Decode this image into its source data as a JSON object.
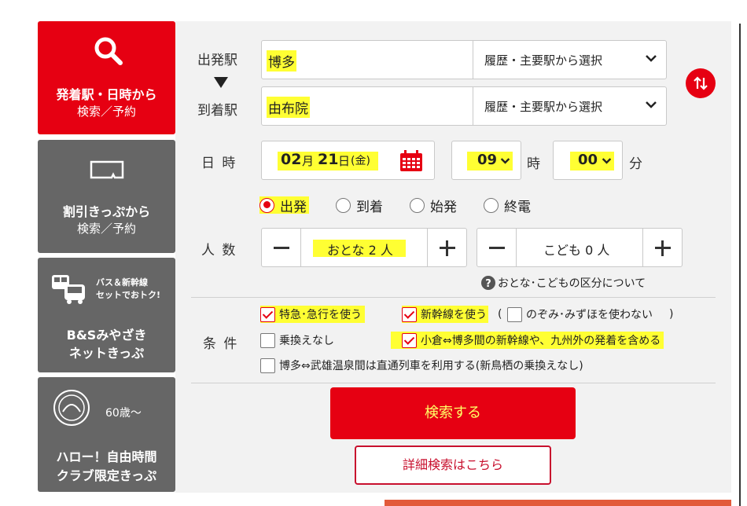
{
  "nav": {
    "tab1": {
      "line1": "発着駅・日時から",
      "line2": "検索／予約"
    },
    "tab2": {
      "line1": "割引きっぷから",
      "line2": "検索／予約"
    },
    "tab3": {
      "badge1": "バス＆新幹線",
      "badge2": "セットでおトク!",
      "line1": "B&Sみやざき",
      "line2": "ネットきっぷ"
    },
    "tab4": {
      "age": "60歳〜",
      "line1": "ハロー！自由時間",
      "line2": "クラブ限定きっぷ"
    }
  },
  "labels": {
    "departure": "出発駅",
    "arrival": "到着駅",
    "datetime": "日 時",
    "people": "人 数",
    "conditions": "条 件",
    "hour_unit": "時",
    "minute_unit": "分"
  },
  "departure": {
    "value": "博多",
    "select": "履歴・主要駅から選択"
  },
  "arrival": {
    "value": "由布院",
    "select": "履歴・主要駅から選択"
  },
  "date": {
    "month": "02",
    "month_unit": "月",
    "day": "21",
    "day_unit": "日",
    "weekday": "(金)",
    "hour": "09",
    "minute": "00"
  },
  "time_type": {
    "options": [
      "出発",
      "到着",
      "始発",
      "終電"
    ],
    "selected": "出発"
  },
  "passengers": {
    "adult": "おとな 2 人",
    "child": "こども 0 人",
    "help_link": "おとな･こどもの区分について"
  },
  "conditions": {
    "express": "特急･急行を使う",
    "shinkansen": "新幹線を使う",
    "paren_open": "(",
    "no_nozomi": "のぞみ･みずほを使わない",
    "paren_close": ")",
    "no_transfer": "乗換えなし",
    "kokura": "小倉⇔博多間の新幹線や、九州外の発着を含める",
    "takeo": "博多⇔武雄温泉間は直通列車を利用する(新鳥栖の乗換えなし)"
  },
  "buttons": {
    "search": "検索する",
    "detail": "詳細検索はこちら"
  },
  "colors": {
    "brand_red": "#e60012",
    "tab_gray": "#666666",
    "highlight": "#ffff33",
    "panel_bg": "#f2f2f2"
  }
}
